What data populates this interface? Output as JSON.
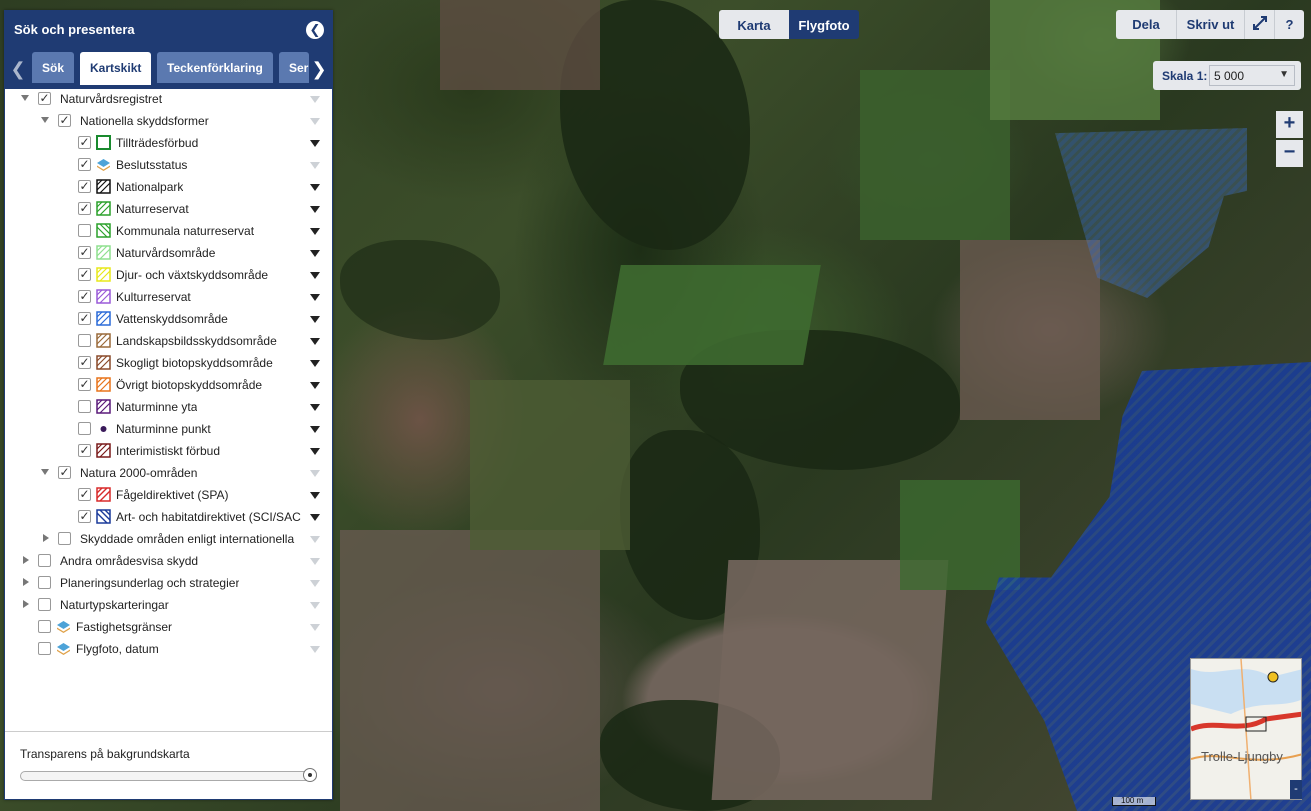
{
  "panel": {
    "title": "Sök och presentera",
    "tabs": [
      {
        "label": "Sök"
      },
      {
        "label": "Kartskikt"
      },
      {
        "label": "Teckenförklaring"
      },
      {
        "label": "Ser"
      }
    ],
    "layers": {
      "naturvard": "Naturvårdsregistret",
      "nationella": "Nationella skyddsformer",
      "tilltrades": "Tillträdesförbud",
      "beslut": "Beslutsstatus",
      "nationalpark": "Nationalpark",
      "naturreservat": "Naturreservat",
      "kommunala": "Kommunala naturreservat",
      "naturvardsomr": "Naturvårdsområde",
      "djur": "Djur- och växtskyddsområde",
      "kultur": "Kulturreservat",
      "vatten": "Vattenskyddsområde",
      "landskap": "Landskapsbildsskyddsområde",
      "skogligt": "Skogligt biotopskyddsområde",
      "ovrigt": "Övrigt biotopskyddsområde",
      "nm_yta": "Naturminne yta",
      "nm_punkt": "Naturminne punkt",
      "interim": "Interimistiskt förbud",
      "natura": "Natura 2000-områden",
      "fagel": "Fågeldirektivet (SPA)",
      "art": "Art- och habitatdirektivet (SCI/SAC",
      "skyddade": "Skyddade områden enligt internationella",
      "andra": "Andra områdesvisa skydd",
      "planering": "Planeringsunderlag och strategier",
      "naturtyp": "Naturtypskarteringar",
      "fastighet": "Fastighetsgränser",
      "flygdatum": "Flygfoto, datum"
    },
    "transparency_label": "Transparens på bakgrundskarta",
    "transparency_value": 1.0
  },
  "map_toggle": {
    "karta": "Karta",
    "flygfoto": "Flygfoto"
  },
  "toolbar": {
    "dela": "Dela",
    "skriv_ut": "Skriv ut",
    "help": "?"
  },
  "scale": {
    "label": "Skala 1:",
    "value": "5 000"
  },
  "zoom": {
    "in": "+",
    "out": "−"
  },
  "overview": {
    "place": "Trolle-Ljungby",
    "minimize": "-"
  },
  "scalebar": {
    "text": "100 m"
  },
  "colors": {
    "brand": "#1f3b73",
    "protected_fill": "#1e50c8",
    "checkbox": "#333333"
  }
}
